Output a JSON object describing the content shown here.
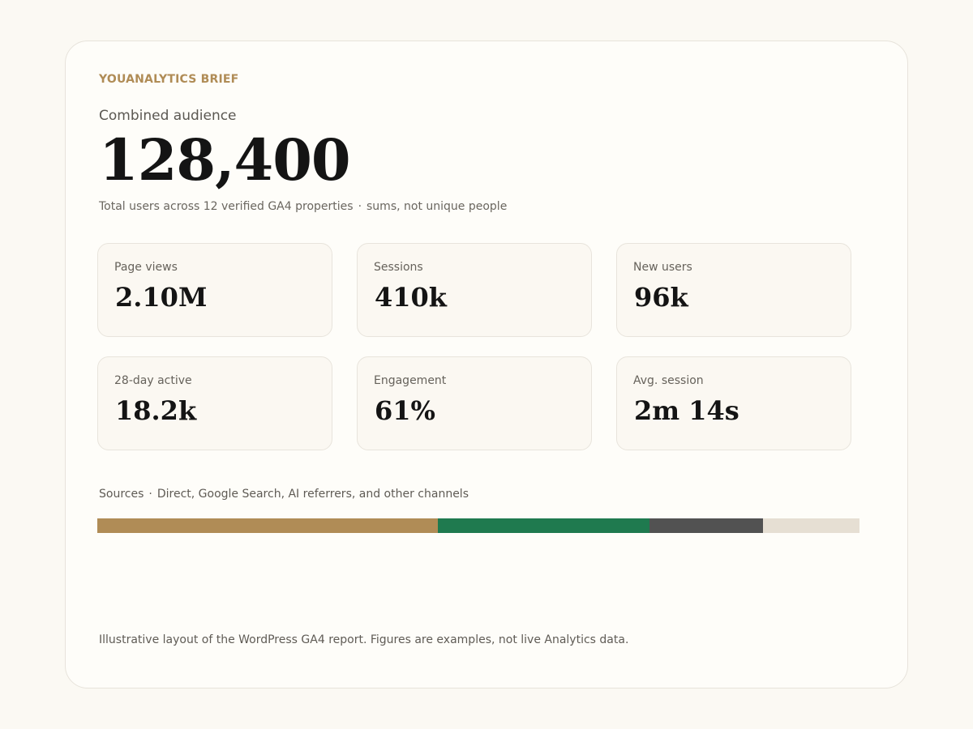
{
  "brand": "YOUANALYTICS BRIEF",
  "audience": {
    "subtitle": "Combined audience",
    "total": "128,400",
    "caption_main": "Total users across 12 verified GA4 properties",
    "caption_sep": "·",
    "caption_note": "sums, not unique people"
  },
  "metrics": [
    {
      "label": "Page views",
      "value": "2.10M"
    },
    {
      "label": "Sessions",
      "value": "410k"
    },
    {
      "label": "New users",
      "value": "96k"
    },
    {
      "label": "28-day active",
      "value": "18.2k"
    },
    {
      "label": "Engagement",
      "value": "61%"
    },
    {
      "label": "Avg. session",
      "value": "2m 14s"
    }
  ],
  "sources": {
    "label": "Sources",
    "sep": "·",
    "description": "Direct, Google Search, AI referrers, and other channels",
    "segments": [
      {
        "share": 44.7,
        "color": "#b08c56"
      },
      {
        "share": 27.7,
        "color": "#1f7a4f"
      },
      {
        "share": 14.9,
        "color": "#525252"
      },
      {
        "share": 12.7,
        "color": "#e6dfd3"
      }
    ]
  },
  "footnote": "Illustrative layout of the WordPress GA4 report. Figures are examples, not live Analytics data."
}
